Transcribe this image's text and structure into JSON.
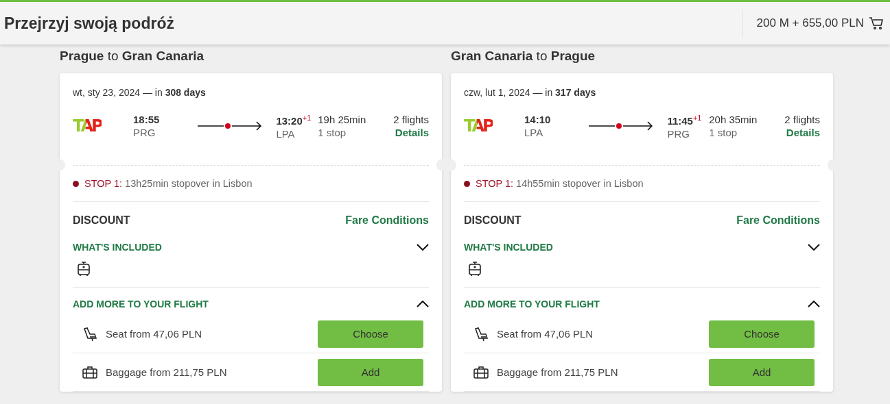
{
  "header": {
    "title": "Przejrzyj swoją podróż",
    "total": "200 M + 655,00 PLN"
  },
  "trips": [
    {
      "title": "**Prague** to **Gran Canaria**",
      "date": "wt, sty 23, 2024 — in **308 days**",
      "airline": "TAP",
      "depart_time": "18:55",
      "depart_code": "PRG",
      "arrive_time": "13:20",
      "day_offset": "+1",
      "arrive_code": "LPA",
      "duration": "19h 25min",
      "stops": "1 stop",
      "flights": "2 flights",
      "details": "Details",
      "stop_label": "STOP 1:",
      "stop_text": "13h25min stopover in Lisbon",
      "fare": "DISCOUNT",
      "fare_link": "Fare Conditions",
      "included": {
        "title": "WHAT'S INCLUDED",
        "expanded": false,
        "items": [
          {
            "kind": "carry-on"
          }
        ]
      },
      "addons": {
        "title": "ADD MORE TO YOUR FLIGHT",
        "expanded": true,
        "items": [
          {
            "kind": "seat",
            "text": "Seat from 47,06 PLN",
            "button": "Choose"
          },
          {
            "kind": "baggage",
            "text": "Baggage from 211,75 PLN",
            "button": "Add"
          }
        ]
      }
    },
    {
      "title": "**Gran Canaria** to **Prague**",
      "date": "czw, lut 1, 2024 — in **317 days**",
      "airline": "TAP",
      "depart_time": "14:10",
      "depart_code": "LPA",
      "arrive_time": "11:45",
      "day_offset": "+1",
      "arrive_code": "PRG",
      "duration": "20h 35min",
      "stops": "1 stop",
      "flights": "2 flights",
      "details": "Details",
      "stop_label": "STOP 1:",
      "stop_text": "14h55min stopover in Lisbon",
      "fare": "DISCOUNT",
      "fare_link": "Fare Conditions",
      "included": {
        "title": "WHAT'S INCLUDED",
        "expanded": false,
        "items": [
          {
            "kind": "carry-on"
          }
        ]
      },
      "addons": {
        "title": "ADD MORE TO YOUR FLIGHT",
        "expanded": true,
        "items": [
          {
            "kind": "seat",
            "text": "Seat from 47,06 PLN",
            "button": "Choose"
          },
          {
            "kind": "baggage",
            "text": "Baggage from 211,75 PLN",
            "button": "Add"
          }
        ]
      }
    }
  ]
}
